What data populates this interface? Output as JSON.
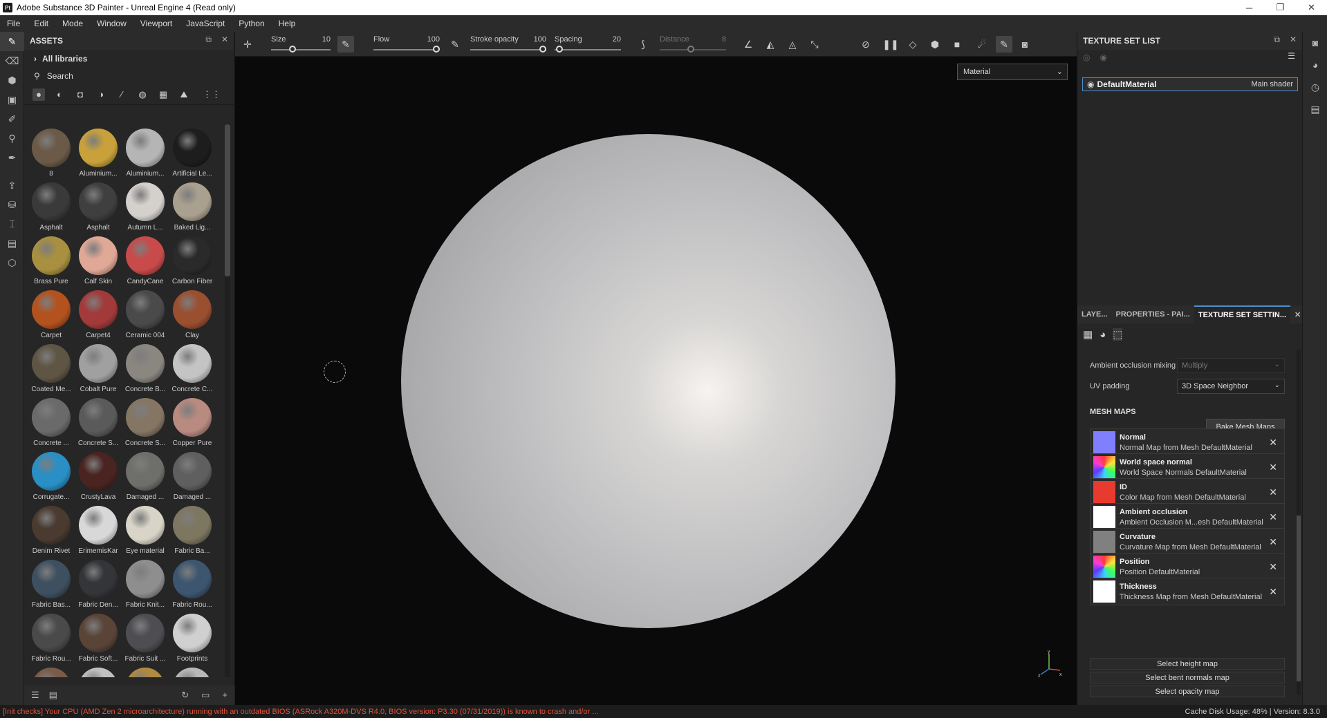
{
  "window": {
    "title": "Adobe Substance 3D Painter - Unreal Engine 4 (Read only)",
    "app_badge": "Pt",
    "min": "─",
    "max": "❐",
    "close": "✕"
  },
  "menu": [
    "File",
    "Edit",
    "Mode",
    "Window",
    "Viewport",
    "JavaScript",
    "Python",
    "Help"
  ],
  "assets": {
    "title": "ASSETS",
    "libraries": "All libraries",
    "search_placeholder": "Search",
    "items": [
      {
        "name": "8",
        "color": "#6b5a48"
      },
      {
        "name": "Aluminium...",
        "color": "#c9a13a"
      },
      {
        "name": "Aluminium...",
        "color": "#b5b5b5"
      },
      {
        "name": "Artificial Le...",
        "color": "#1d1d1d"
      },
      {
        "name": "Asphalt",
        "color": "#3a3a3a"
      },
      {
        "name": "Asphalt",
        "color": "#3f3f3f"
      },
      {
        "name": "Autumn L...",
        "color": "#d4d0cc"
      },
      {
        "name": "Baked Lig...",
        "color": "#a9a08f"
      },
      {
        "name": "Brass Pure",
        "color": "#a89040"
      },
      {
        "name": "Calf Skin",
        "color": "#e0a896"
      },
      {
        "name": "CandyCane",
        "color": "#c94a4a"
      },
      {
        "name": "Carbon Fiber",
        "color": "#2a2a2a"
      },
      {
        "name": "Carpet",
        "color": "#b3521f"
      },
      {
        "name": "Carpet4",
        "color": "#a33a3a"
      },
      {
        "name": "Ceramic 004",
        "color": "#4a4a4a"
      },
      {
        "name": "Clay",
        "color": "#9a4f30"
      },
      {
        "name": "Coated Me...",
        "color": "#5e5544"
      },
      {
        "name": "Cobalt Pure",
        "color": "#a0a0a0"
      },
      {
        "name": "Concrete B...",
        "color": "#8a8680"
      },
      {
        "name": "Concrete C...",
        "color": "#c4c4c4"
      },
      {
        "name": "Concrete ...",
        "color": "#6a6a6a"
      },
      {
        "name": "Concrete S...",
        "color": "#5a5a5a"
      },
      {
        "name": "Concrete S...",
        "color": "#857664"
      },
      {
        "name": "Copper Pure",
        "color": "#b88a80"
      },
      {
        "name": "Corrugate...",
        "color": "#2a8fc4"
      },
      {
        "name": "CrustyLava",
        "color": "#4a2420"
      },
      {
        "name": "Damaged ...",
        "color": "#6e6e6a"
      },
      {
        "name": "Damaged ...",
        "color": "#5f5f5f"
      },
      {
        "name": "Denim Rivet",
        "color": "#4a3a30"
      },
      {
        "name": "ErimemisKar",
        "color": "#d8d8d8"
      },
      {
        "name": "Eye material",
        "color": "#d9d4c8"
      },
      {
        "name": "Fabric Ba...",
        "color": "#7d7660"
      },
      {
        "name": "Fabric Bas...",
        "color": "#3e5060"
      },
      {
        "name": "Fabric Den...",
        "color": "#333538"
      },
      {
        "name": "Fabric Knit...",
        "color": "#8e8e8e"
      },
      {
        "name": "Fabric Rou...",
        "color": "#3d5670"
      },
      {
        "name": "Fabric Rou...",
        "color": "#4a4a4a"
      },
      {
        "name": "Fabric Soft...",
        "color": "#5a4438"
      },
      {
        "name": "Fabric Suit ...",
        "color": "#4e4e52"
      },
      {
        "name": "Footprints",
        "color": "#d0d0d0"
      },
      {
        "name": "",
        "color": "#7a5a48"
      },
      {
        "name": "",
        "color": "#c0c0c0"
      },
      {
        "name": "",
        "color": "#b08a40"
      },
      {
        "name": "",
        "color": "#b8b8b8"
      }
    ]
  },
  "toolbar": {
    "size_label": "Size",
    "size_value": "10",
    "flow_label": "Flow",
    "flow_value": "100",
    "stroke_label": "Stroke opacity",
    "stroke_value": "100",
    "spacing_label": "Spacing",
    "spacing_value": "20",
    "distance_label": "Distance",
    "distance_value": "8"
  },
  "viewport": {
    "mode": "Material"
  },
  "texture_set": {
    "title": "TEXTURE SET LIST",
    "material": "DefaultMaterial",
    "shader": "Main shader"
  },
  "tabs": [
    "LAYE...",
    "PROPERTIES - PAI...",
    "TEXTURE SET SETTIN..."
  ],
  "settings": {
    "ao_mixing_label": "Ambient occlusion mixing",
    "ao_mixing_value": "Multiply",
    "uv_padding_label": "UV padding",
    "uv_padding_value": "3D Space Neighbor",
    "mesh_maps_header": "MESH MAPS",
    "bake_button": "Bake Mesh Maps",
    "maps": [
      {
        "name": "Normal",
        "desc": "Normal Map from Mesh DefaultMaterial",
        "color": "#8080ff"
      },
      {
        "name": "World space normal",
        "desc": "World Space Normals DefaultMaterial",
        "color": "rainbow"
      },
      {
        "name": "ID",
        "desc": "Color Map from Mesh DefaultMaterial",
        "color": "#e83a2e"
      },
      {
        "name": "Ambient occlusion",
        "desc": "Ambient Occlusion M...esh DefaultMaterial",
        "color": "#ffffff"
      },
      {
        "name": "Curvature",
        "desc": "Curvature Map from Mesh DefaultMaterial",
        "color": "#808080"
      },
      {
        "name": "Position",
        "desc": "Position DefaultMaterial",
        "color": "rainbow"
      },
      {
        "name": "Thickness",
        "desc": "Thickness Map from Mesh DefaultMaterial",
        "color": "#ffffff"
      }
    ],
    "select_height": "Select height map",
    "select_bent": "Select bent normals map",
    "select_opacity": "Select opacity map"
  },
  "status": {
    "error": "[Init checks] Your CPU (AMD Zen 2 microarchitecture) running with an outdated BIOS (ASRock A320M-DVS R4.0, BIOS version: P3.30 (07/31/2019)) is known to crash and/or ...",
    "info": "Cache Disk Usage:   48% | Version: 8.3.0"
  }
}
